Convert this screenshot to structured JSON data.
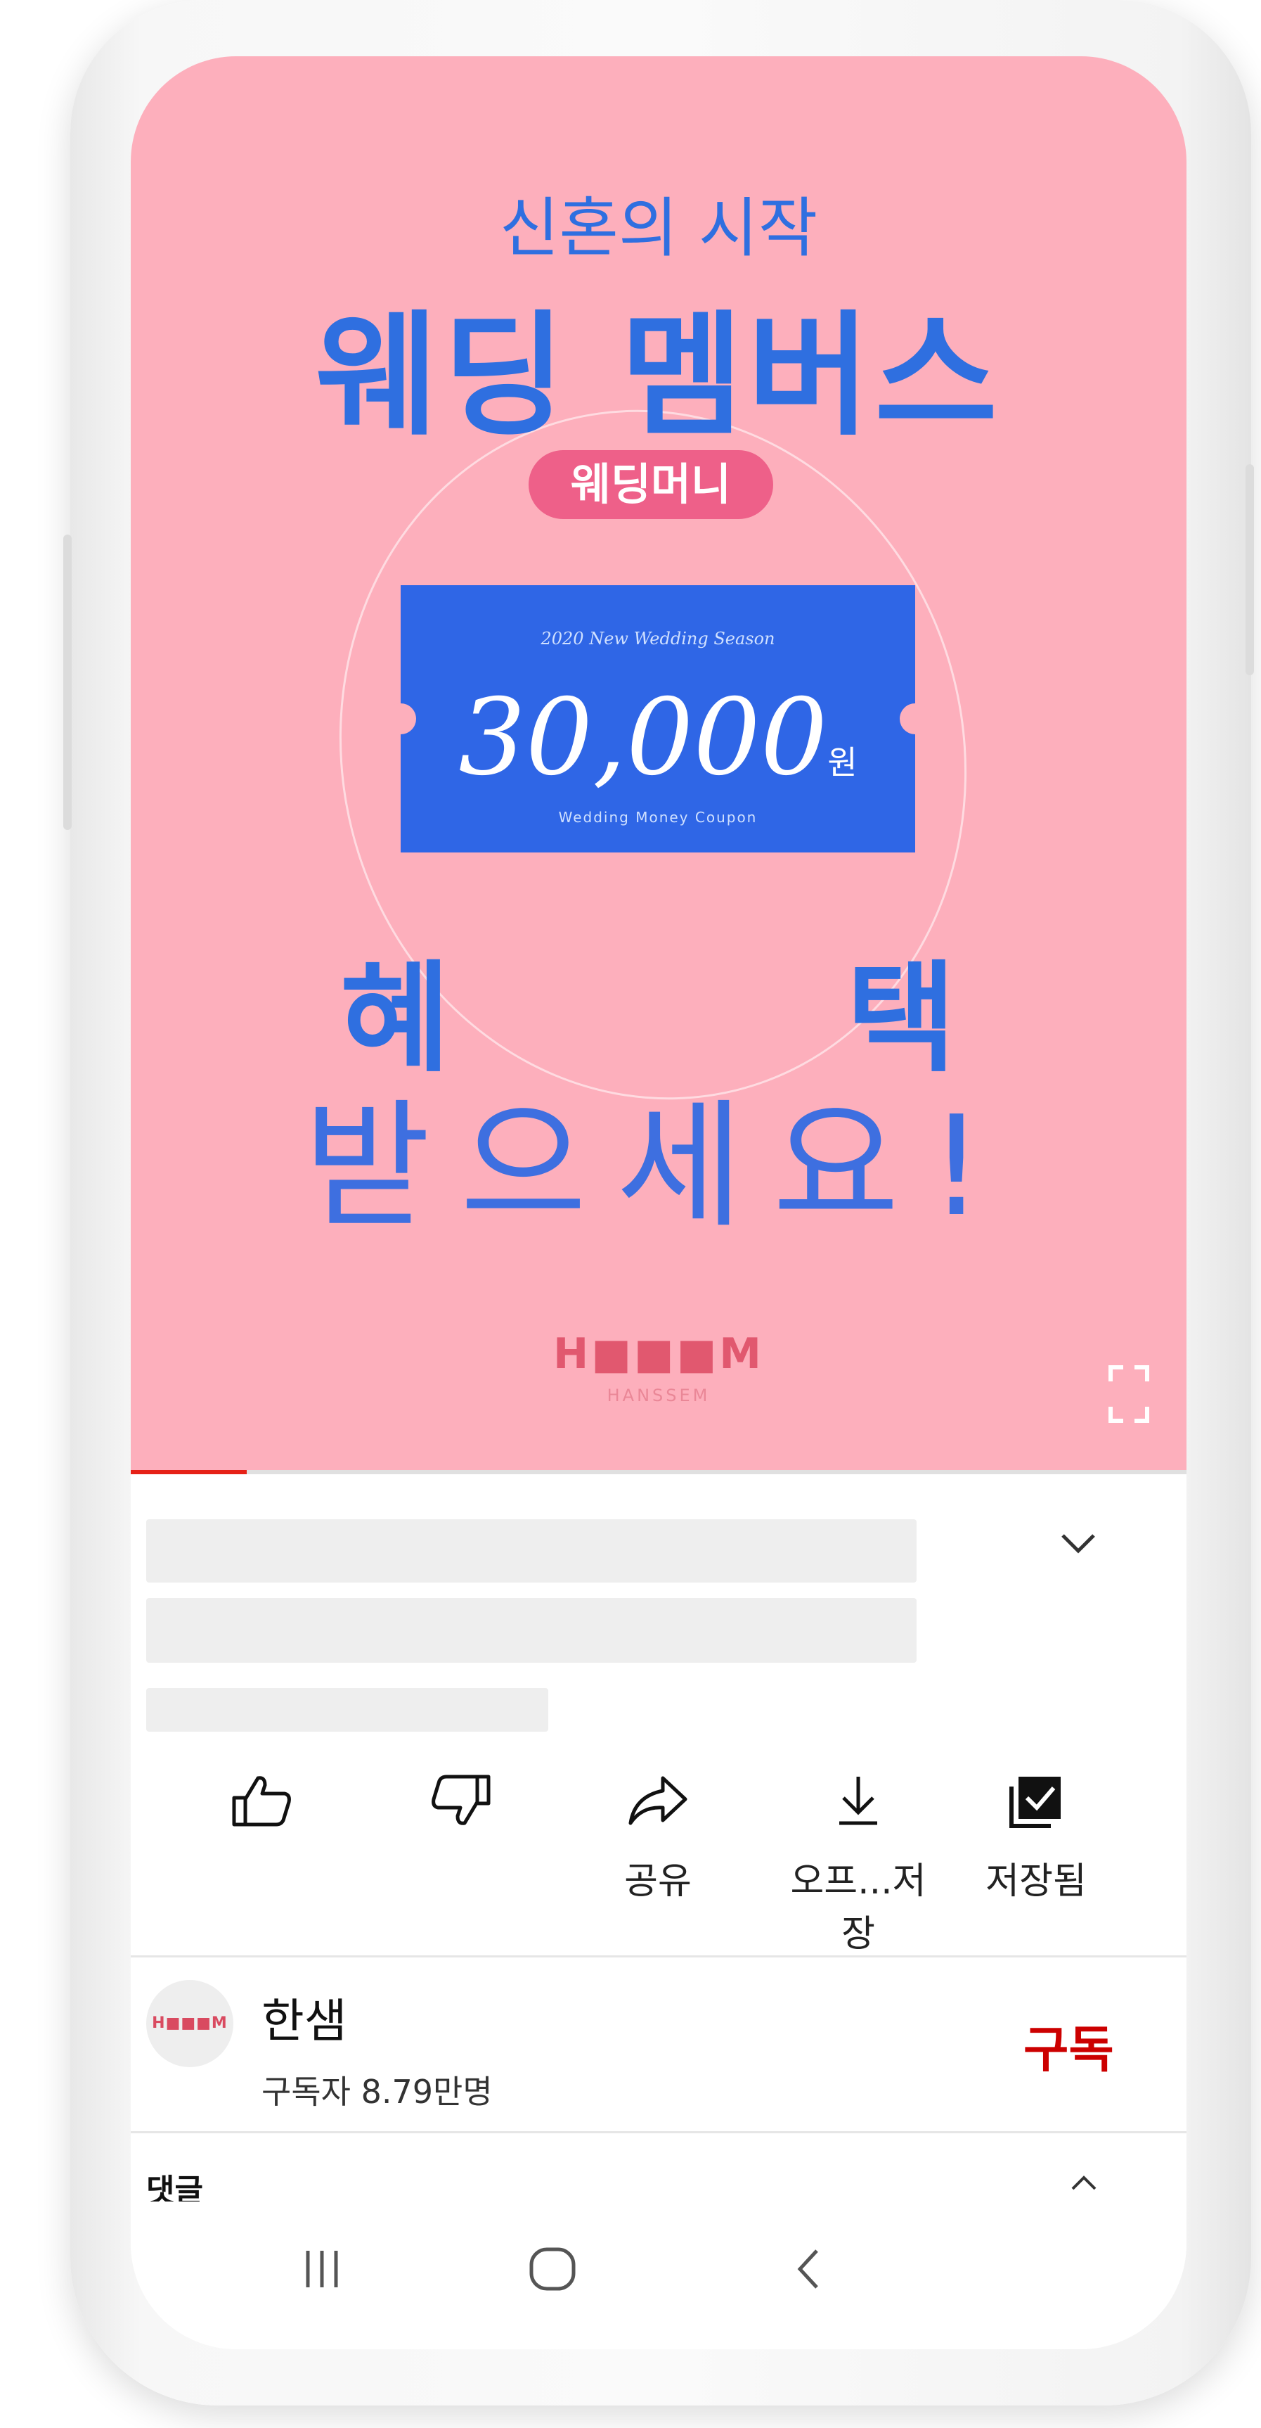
{
  "video": {
    "kicker": "신혼의 시작",
    "headline": "웨딩 멤버스",
    "pill": "웨딩머니",
    "ticket_top": "2020 New Wedding Season",
    "ticket_amount": "30,000",
    "ticket_currency": "원",
    "ticket_bottom": "Wedding Money Coupon",
    "char_left": "혜",
    "char_right": "택",
    "subline": "받으세요!",
    "logo": "HANSSEM",
    "logo_mark": "H■■■M",
    "progress_fraction": 0.11
  },
  "actions": [
    {
      "icon": "thumbs-up-icon",
      "label": ""
    },
    {
      "icon": "thumbs-down-icon",
      "label": ""
    },
    {
      "icon": "share-icon",
      "label": "공유"
    },
    {
      "icon": "download-icon",
      "label": "오프...저장"
    },
    {
      "icon": "saved-checkbox-icon",
      "label": "저장됨"
    }
  ],
  "channel": {
    "name": "한샘",
    "subscribers": "구독자 8.79만명",
    "subscribe_label": "구독",
    "avatar_text": "H■■■M"
  },
  "comments": {
    "label": "댓글"
  },
  "colors": {
    "video_bg": "#fdafbc",
    "accent_blue": "#2f6fe0",
    "pill_pink": "#ee6089",
    "progress_red": "#e62117",
    "subscribe_red": "#cc0000"
  }
}
